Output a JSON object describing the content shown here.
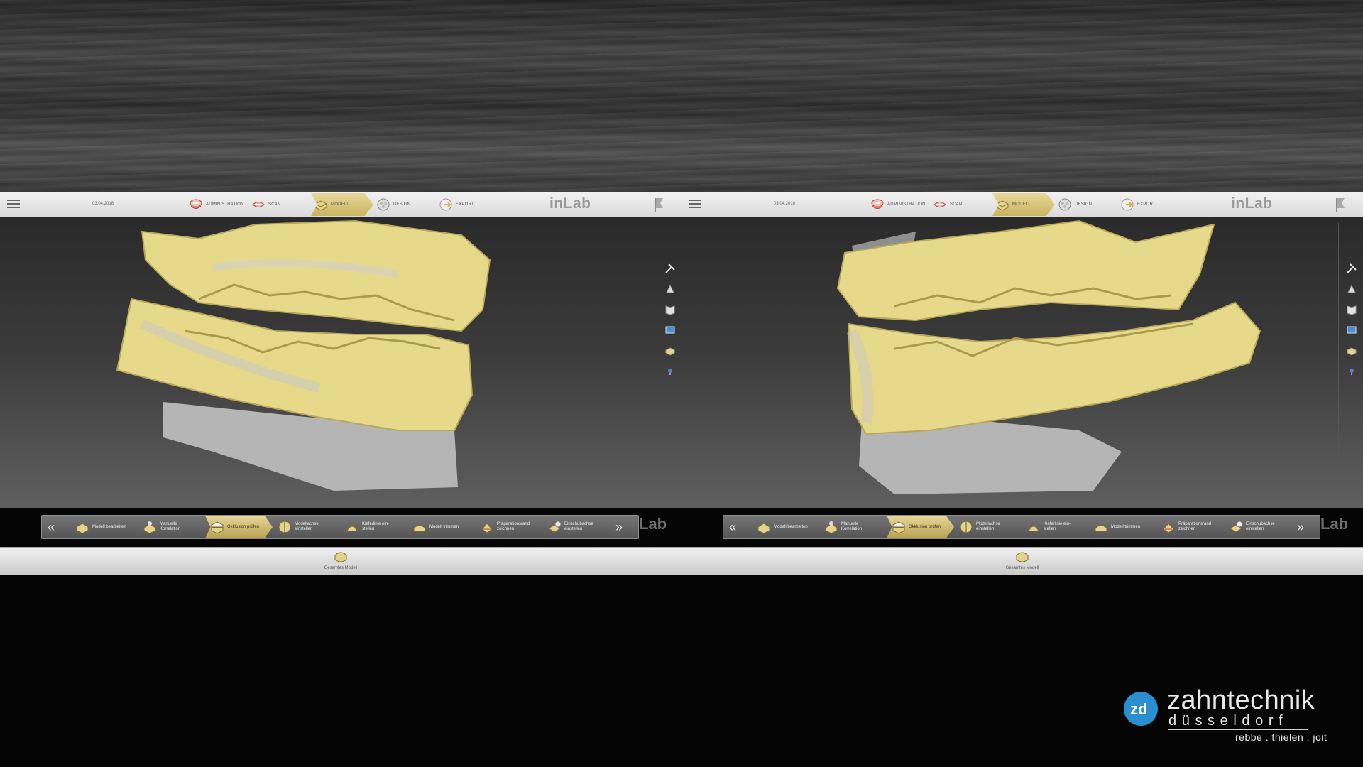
{
  "panels": [
    {
      "id": "left",
      "date": "03.04.2018",
      "workflow_steps": [
        {
          "label": "ADMINISTRATION",
          "icon": "administration-icon",
          "active": false
        },
        {
          "label": "SCAN",
          "icon": "scan-icon",
          "active": false
        },
        {
          "label": "MODELL",
          "icon": "modell-icon",
          "active": true
        },
        {
          "label": "DESIGN",
          "icon": "design-icon",
          "active": false
        },
        {
          "label": "EXPORT",
          "icon": "export-icon",
          "active": false
        }
      ],
      "brand": "inLab",
      "side_tools": [
        "tools-icon",
        "anatomy-tool-icon",
        "book-icon",
        "monitor-icon",
        "model-toggle-icon",
        "bulb-icon"
      ],
      "toolbar_items": [
        {
          "label": "Modell bearbeiten",
          "icon": "model-edit-icon",
          "active": false
        },
        {
          "label": "Manuelle Korrelation",
          "icon": "correlation-icon",
          "active": false
        },
        {
          "label": "Okklusion prüfen",
          "icon": "occlusion-icon",
          "active": true
        },
        {
          "label": "Modellachse einstellen",
          "icon": "model-axis-icon",
          "active": false
        },
        {
          "label": "Kieferlinie ein-stellen",
          "icon": "jaw-line-icon",
          "active": false
        },
        {
          "label": "Modell trimmen",
          "icon": "trim-icon",
          "active": false
        },
        {
          "label": "Präparationsrand zeichnen",
          "icon": "margin-icon",
          "active": false
        },
        {
          "label": "Einschubachse einstellen",
          "icon": "insertion-axis-icon",
          "active": false
        }
      ],
      "lab_watermark": "Lab",
      "bottom_label": "Gesamtes Modell"
    },
    {
      "id": "right",
      "date": "03.04.2018",
      "workflow_steps": [
        {
          "label": "ADMINISTRATION",
          "icon": "administration-icon",
          "active": false
        },
        {
          "label": "SCAN",
          "icon": "scan-icon",
          "active": false
        },
        {
          "label": "MODELL",
          "icon": "modell-icon",
          "active": true
        },
        {
          "label": "DESIGN",
          "icon": "design-icon",
          "active": false
        },
        {
          "label": "EXPORT",
          "icon": "export-icon",
          "active": false
        }
      ],
      "brand": "inLab",
      "side_tools": [
        "tools-icon",
        "anatomy-tool-icon",
        "book-icon",
        "monitor-icon",
        "model-toggle-icon",
        "bulb-icon"
      ],
      "toolbar_items": [
        {
          "label": "Modell bearbeiten",
          "icon": "model-edit-icon",
          "active": false
        },
        {
          "label": "Manuelle Korrelation",
          "icon": "correlation-icon",
          "active": false
        },
        {
          "label": "Okklusion prüfen",
          "icon": "occlusion-icon",
          "active": true
        },
        {
          "label": "Modellachse einstellen",
          "icon": "model-axis-icon",
          "active": false
        },
        {
          "label": "Kieferlinie ein-stellen",
          "icon": "jaw-line-icon",
          "active": false
        },
        {
          "label": "Modell trimmen",
          "icon": "trim-icon",
          "active": false
        },
        {
          "label": "Präparationsrand zeichnen",
          "icon": "margin-icon",
          "active": false
        },
        {
          "label": "Einschubachse einstellen",
          "icon": "insertion-axis-icon",
          "active": false
        }
      ],
      "lab_watermark": "Lab",
      "bottom_label": "Gesamtes Modell"
    }
  ],
  "logo": {
    "name": "zahntechnik",
    "city": "düsseldorf",
    "tagline": "rebbe . thielen . joit",
    "color": "#2a8fd0"
  },
  "colors": {
    "model_yellow": "#e6d98a",
    "active_gold": "#d4c27a",
    "gray_scan": "#bdbdbd"
  }
}
